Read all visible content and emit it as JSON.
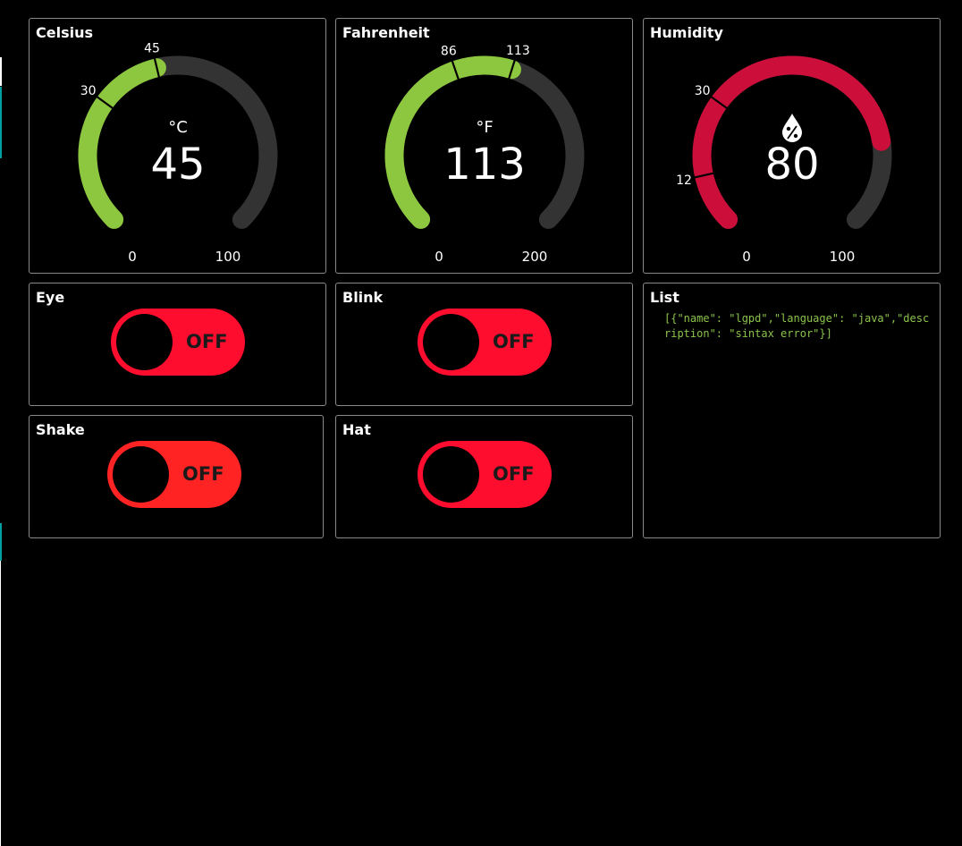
{
  "colors": {
    "background": "#000000",
    "card_border": "#8a8a8a",
    "track": "#333333",
    "green": "#8dc63f",
    "crimson": "#cc0e3a",
    "toggle_off": "#ff0d2e",
    "toggle_off_alt": "#ff2323",
    "list_text": "#8bc34a",
    "edge_accent": "#00a0a0"
  },
  "gauges": [
    {
      "title": "Celsius",
      "unit": "°C",
      "unit_icon": "",
      "value": 45,
      "value_text": "45",
      "min": 0,
      "min_text": "0",
      "max": 100,
      "max_text": "100",
      "color": "#8dc63f",
      "markers": [
        {
          "value": 30,
          "label": "30"
        },
        {
          "value": 45,
          "label": "45"
        }
      ]
    },
    {
      "title": "Fahrenheit",
      "unit": "°F",
      "unit_icon": "",
      "value": 113,
      "value_text": "113",
      "min": 0,
      "min_text": "0",
      "max": 200,
      "max_text": "200",
      "color": "#8dc63f",
      "markers": [
        {
          "value": 86,
          "label": "86"
        },
        {
          "value": 113,
          "label": "113"
        }
      ]
    },
    {
      "title": "Humidity",
      "unit": "",
      "unit_icon": "humidity-drop-icon",
      "value": 80,
      "value_text": "80",
      "min": 0,
      "min_text": "0",
      "max": 100,
      "max_text": "100",
      "color": "#cc0e3a",
      "markers": [
        {
          "value": 12,
          "label": "12"
        },
        {
          "value": 30,
          "label": "30"
        }
      ]
    }
  ],
  "switches": [
    {
      "title": "Eye",
      "state": "OFF",
      "color": "#ff0d2e"
    },
    {
      "title": "Blink",
      "state": "OFF",
      "color": "#ff0d2e"
    },
    {
      "title": "Shake",
      "state": "OFF",
      "color": "#ff2323"
    },
    {
      "title": "Hat",
      "state": "OFF",
      "color": "#ff0d2e"
    }
  ],
  "list": {
    "title": "List",
    "content": "[{\"name\": \"lgpd\",\"language\": \"java\",\"description\": \"sintax error\"}]"
  }
}
